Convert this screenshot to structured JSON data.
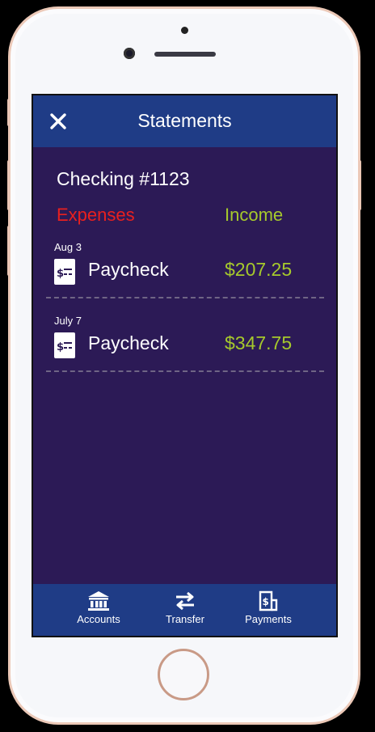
{
  "header": {
    "title": "Statements",
    "close_icon": "close-icon"
  },
  "account": {
    "name": "Checking #1123"
  },
  "columns": {
    "expenses": "Expenses",
    "income": "Income"
  },
  "colors": {
    "expenses": "#e8201f",
    "income": "#a6c92c",
    "bar": "#1f3c86",
    "background": "#2c1a56"
  },
  "transactions": [
    {
      "date": "Aug 3",
      "name": "Paycheck",
      "amount": "$207.25",
      "icon": "check-receipt-icon"
    },
    {
      "date": "July 7",
      "name": "Paycheck",
      "amount": "$347.75",
      "icon": "check-receipt-icon"
    }
  ],
  "tabs": [
    {
      "label": "Accounts",
      "icon": "bank-icon"
    },
    {
      "label": "Transfer",
      "icon": "transfer-arrows-icon"
    },
    {
      "label": "Payments",
      "icon": "bill-payment-icon"
    }
  ]
}
